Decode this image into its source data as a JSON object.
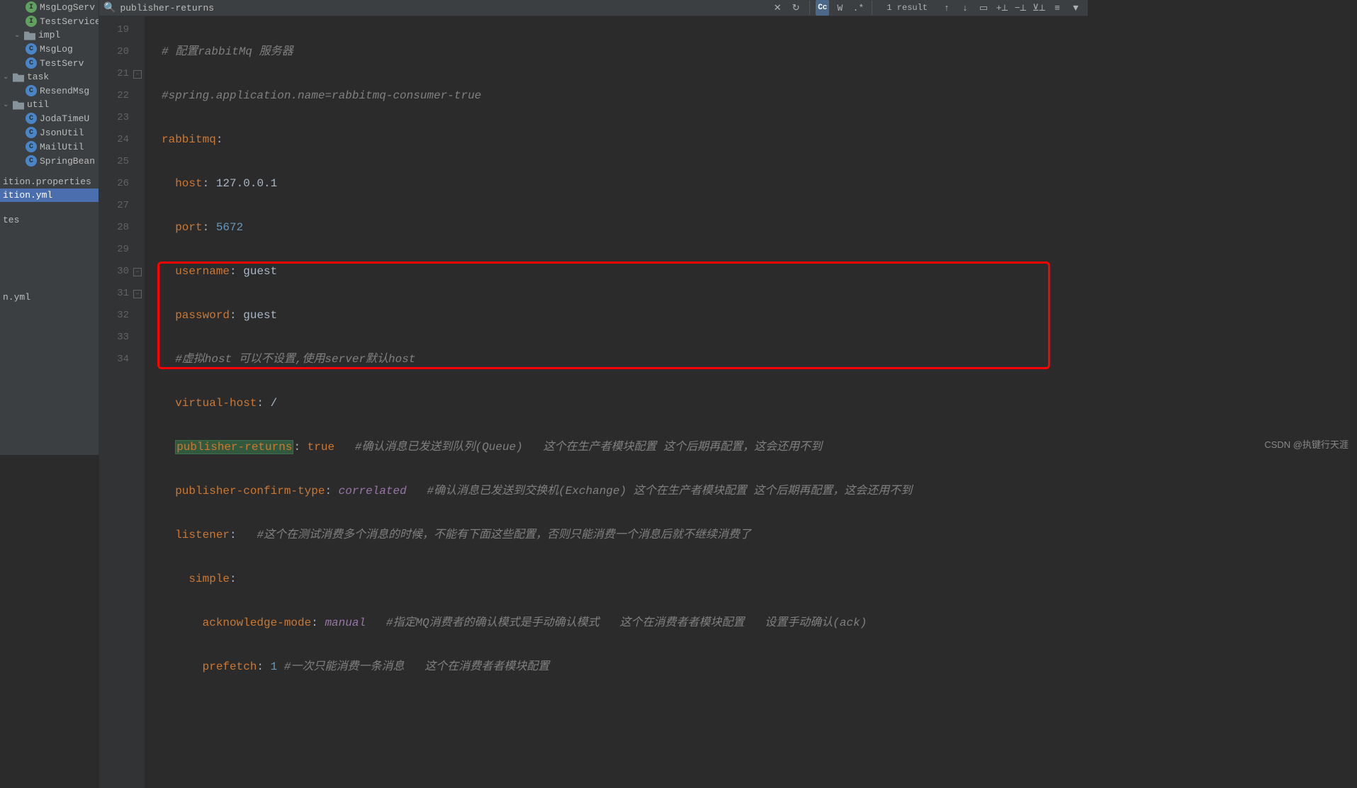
{
  "sidebar": {
    "items": [
      {
        "label": "MsgLogServ"
      },
      {
        "label": "TestService"
      },
      {
        "label": "impl"
      },
      {
        "label": "MsgLog"
      },
      {
        "label": "TestServ"
      },
      {
        "label": "task"
      },
      {
        "label": "ResendMsg"
      },
      {
        "label": "util"
      },
      {
        "label": "JodaTimeU"
      },
      {
        "label": "JsonUtil"
      },
      {
        "label": "MailUtil"
      },
      {
        "label": "SpringBean"
      },
      {
        "label": "ition.properties"
      },
      {
        "label": "ition.yml"
      },
      {
        "label": "tes"
      },
      {
        "label": "n.yml"
      }
    ]
  },
  "search": {
    "query": "publisher-returns",
    "cc": "Cc",
    "w": "W",
    "regex": ".*",
    "result_count": "1 result"
  },
  "gutter": [
    "19",
    "20",
    "21",
    "22",
    "23",
    "24",
    "25",
    "26",
    "27",
    "28",
    "29",
    "30",
    "31",
    "32",
    "33",
    "34"
  ],
  "code": {
    "colon": ":",
    "l19": {
      "a": "# 配置rabbitMq 服务器"
    },
    "l20": {
      "a": "#spring.application.name=rabbitmq-consumer-true"
    },
    "l21": {
      "a": "rabbitmq"
    },
    "l22": {
      "a": "host",
      "b": "127.0.0.1"
    },
    "l23": {
      "a": "port",
      "b": "5672"
    },
    "l24": {
      "a": "username",
      "b": "guest"
    },
    "l25": {
      "a": "password",
      "b": "guest"
    },
    "l26": {
      "a": "#虚拟host 可以不设置,使用server默认host"
    },
    "l27": {
      "a": "virtual-host",
      "b": "/"
    },
    "l28": {
      "a": "publisher-returns",
      "b": "true",
      "c": "#确认消息已发送到队列(Queue)   这个在生产者模块配置 这个后期再配置，这会还用不到"
    },
    "l29": {
      "a": "publisher-confirm-type",
      "b": "correlated",
      "c": "#确认消息已发送到交换机(Exchange) 这个在生产者模块配置 这个后期再配置，这会还用不到"
    },
    "l30": {
      "a": "listener",
      "b": "#这个在测试消费多个消息的时候，不能有下面这些配置，否则只能消费一个消息后就不继续消费了"
    },
    "l31": {
      "a": "simple"
    },
    "l32": {
      "a": "acknowledge-mode",
      "b": "manual",
      "c": "#指定MQ消费者的确认模式是手动确认模式   这个在消费者者模块配置   设置手动确认(ack)"
    },
    "l33": {
      "a": "prefetch",
      "b": "1",
      "c": "#一次只能消费一条消息   这个在消费者者模块配置"
    }
  },
  "watermark": "CSDN @执键行天涯"
}
